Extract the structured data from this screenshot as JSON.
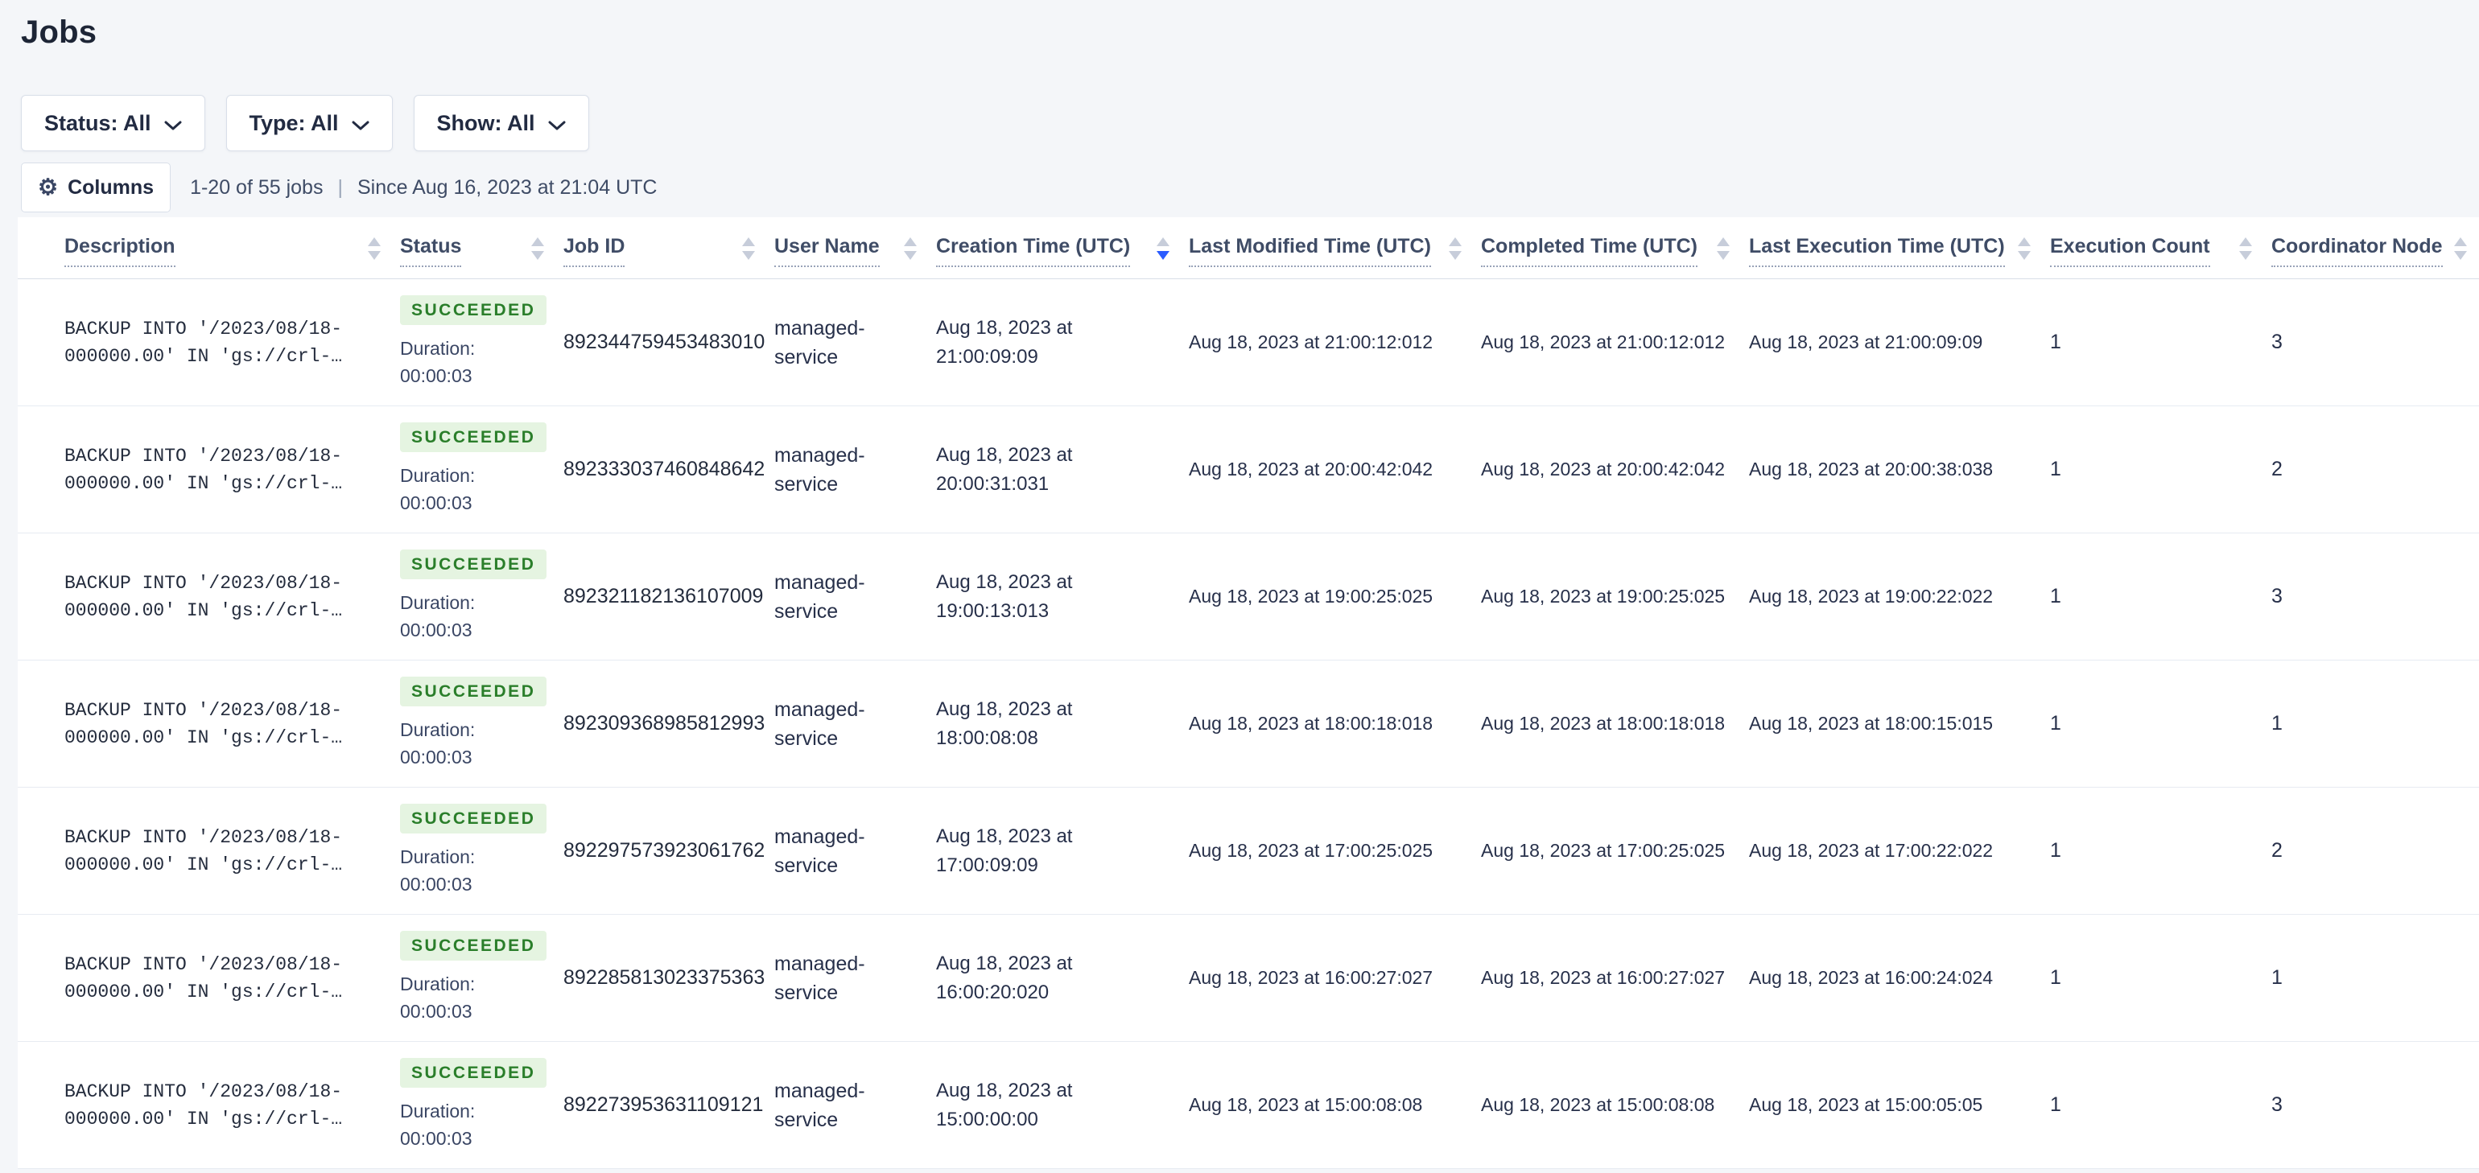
{
  "page": {
    "title": "Jobs"
  },
  "filters": {
    "status": {
      "label": "Status: All"
    },
    "type": {
      "label": "Type: All"
    },
    "show": {
      "label": "Show: All"
    }
  },
  "toolbar": {
    "columns_label": "Columns",
    "columns_icon": "gear-icon",
    "count_text": "1-20 of 55 jobs",
    "separator": "|",
    "since_text": "Since Aug 16, 2023 at 21:04 UTC"
  },
  "colors": {
    "badge_success_bg": "#e5f4e1",
    "badge_success_text": "#2a7e2a",
    "sort_active": "#2b5cff",
    "page_bg": "#f4f6f9"
  },
  "table": {
    "columns": [
      {
        "label": "Description",
        "sort": "none"
      },
      {
        "label": "Status",
        "sort": "none"
      },
      {
        "label": "Job ID",
        "sort": "none"
      },
      {
        "label": "User Name",
        "sort": "none"
      },
      {
        "label": "Creation Time (UTC)",
        "sort": "desc"
      },
      {
        "label": "Last Modified Time (UTC)",
        "sort": "none"
      },
      {
        "label": "Completed Time (UTC)",
        "sort": "none"
      },
      {
        "label": "Last Execution Time (UTC)",
        "sort": "none"
      },
      {
        "label": "Execution Count",
        "sort": "none"
      },
      {
        "label": "Coordinator Node",
        "sort": "none"
      }
    ],
    "rows": [
      {
        "description": "BACKUP INTO '/2023/08/18-\n000000.00' IN 'gs://crl-…",
        "status": "SUCCEEDED",
        "duration": "Duration: 00:00:03",
        "job_id": "892344759453483010",
        "user_name": "managed-service",
        "creation_time": "Aug 18, 2023 at 21:00:09:09",
        "last_modified_time": "Aug 18, 2023 at 21:00:12:012",
        "completed_time": "Aug 18, 2023 at 21:00:12:012",
        "last_execution_time": "Aug 18, 2023 at 21:00:09:09",
        "execution_count": "1",
        "coordinator_node": "3"
      },
      {
        "description": "BACKUP INTO '/2023/08/18-\n000000.00' IN 'gs://crl-…",
        "status": "SUCCEEDED",
        "duration": "Duration: 00:00:03",
        "job_id": "892333037460848642",
        "user_name": "managed-service",
        "creation_time": "Aug 18, 2023 at 20:00:31:031",
        "last_modified_time": "Aug 18, 2023 at 20:00:42:042",
        "completed_time": "Aug 18, 2023 at 20:00:42:042",
        "last_execution_time": "Aug 18, 2023 at 20:00:38:038",
        "execution_count": "1",
        "coordinator_node": "2"
      },
      {
        "description": "BACKUP INTO '/2023/08/18-\n000000.00' IN 'gs://crl-…",
        "status": "SUCCEEDED",
        "duration": "Duration: 00:00:03",
        "job_id": "892321182136107009",
        "user_name": "managed-service",
        "creation_time": "Aug 18, 2023 at 19:00:13:013",
        "last_modified_time": "Aug 18, 2023 at 19:00:25:025",
        "completed_time": "Aug 18, 2023 at 19:00:25:025",
        "last_execution_time": "Aug 18, 2023 at 19:00:22:022",
        "execution_count": "1",
        "coordinator_node": "3"
      },
      {
        "description": "BACKUP INTO '/2023/08/18-\n000000.00' IN 'gs://crl-…",
        "status": "SUCCEEDED",
        "duration": "Duration: 00:00:03",
        "job_id": "892309368985812993",
        "user_name": "managed-service",
        "creation_time": "Aug 18, 2023 at 18:00:08:08",
        "last_modified_time": "Aug 18, 2023 at 18:00:18:018",
        "completed_time": "Aug 18, 2023 at 18:00:18:018",
        "last_execution_time": "Aug 18, 2023 at 18:00:15:015",
        "execution_count": "1",
        "coordinator_node": "1"
      },
      {
        "description": "BACKUP INTO '/2023/08/18-\n000000.00' IN 'gs://crl-…",
        "status": "SUCCEEDED",
        "duration": "Duration: 00:00:03",
        "job_id": "892297573923061762",
        "user_name": "managed-service",
        "creation_time": "Aug 18, 2023 at 17:00:09:09",
        "last_modified_time": "Aug 18, 2023 at 17:00:25:025",
        "completed_time": "Aug 18, 2023 at 17:00:25:025",
        "last_execution_time": "Aug 18, 2023 at 17:00:22:022",
        "execution_count": "1",
        "coordinator_node": "2"
      },
      {
        "description": "BACKUP INTO '/2023/08/18-\n000000.00' IN 'gs://crl-…",
        "status": "SUCCEEDED",
        "duration": "Duration: 00:00:03",
        "job_id": "892285813023375363",
        "user_name": "managed-service",
        "creation_time": "Aug 18, 2023 at 16:00:20:020",
        "last_modified_time": "Aug 18, 2023 at 16:00:27:027",
        "completed_time": "Aug 18, 2023 at 16:00:27:027",
        "last_execution_time": "Aug 18, 2023 at 16:00:24:024",
        "execution_count": "1",
        "coordinator_node": "1"
      },
      {
        "description": "BACKUP INTO '/2023/08/18-\n000000.00' IN 'gs://crl-…",
        "status": "SUCCEEDED",
        "duration": "Duration: 00:00:03",
        "job_id": "892273953631109121",
        "user_name": "managed-service",
        "creation_time": "Aug 18, 2023 at 15:00:00:00",
        "last_modified_time": "Aug 18, 2023 at 15:00:08:08",
        "completed_time": "Aug 18, 2023 at 15:00:08:08",
        "last_execution_time": "Aug 18, 2023 at 15:00:05:05",
        "execution_count": "1",
        "coordinator_node": "3"
      }
    ]
  }
}
